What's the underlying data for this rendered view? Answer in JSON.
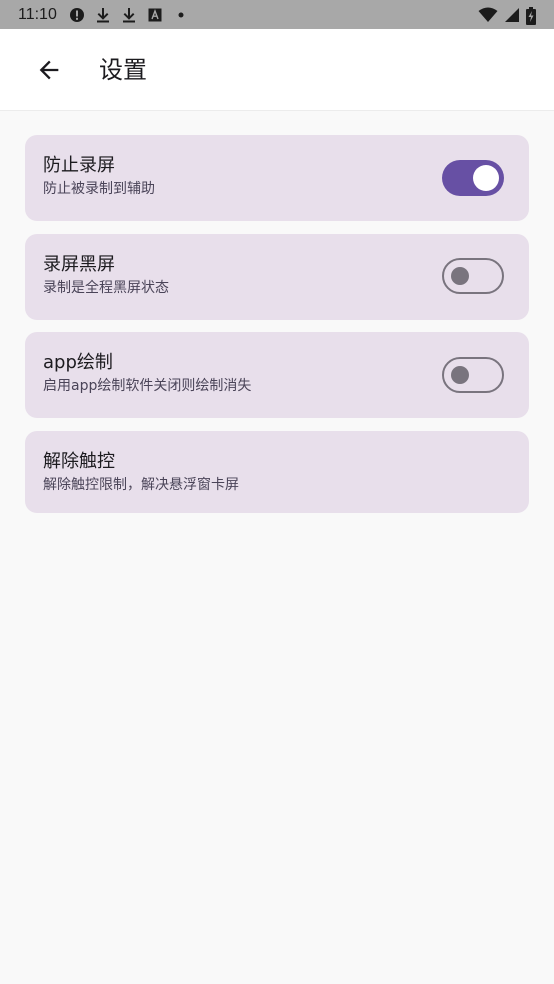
{
  "status_bar": {
    "time": "11:10",
    "icons": [
      "alert-icon",
      "download-icon",
      "download-icon",
      "a-box-icon",
      "dot-icon",
      "wifi-icon",
      "signal-icon",
      "battery-icon"
    ]
  },
  "header": {
    "title": "设置",
    "back_icon": "arrow-left-icon"
  },
  "settings": [
    {
      "title": "防止录屏",
      "subtitle": "防止被录制到辅助",
      "has_switch": true,
      "enabled": true
    },
    {
      "title": "录屏黑屏",
      "subtitle": "录制是全程黑屏状态",
      "has_switch": true,
      "enabled": false
    },
    {
      "title": "app绘制",
      "subtitle": "启用app绘制软件关闭则绘制消失",
      "has_switch": true,
      "enabled": false
    },
    {
      "title": "解除触控",
      "subtitle": "解除触控限制，解决悬浮窗卡屏",
      "has_switch": false
    }
  ],
  "colors": {
    "accent": "#6750a4",
    "card_bg": "#e8dfeb",
    "switch_off": "#79747e"
  }
}
